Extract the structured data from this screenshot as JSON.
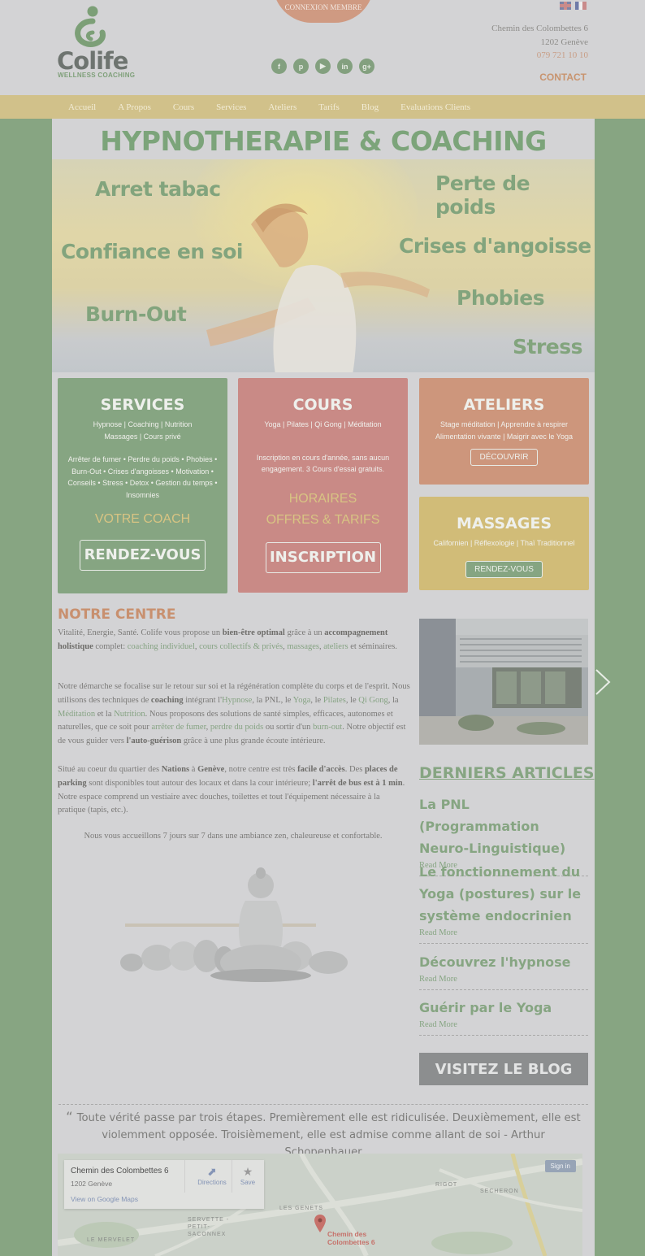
{
  "header": {
    "logo_text": "Colife",
    "logo_subtitle": "WELLNESS COACHING",
    "member_button": "CONNEXION MEMBRE",
    "social_icons": [
      "facebook-icon",
      "pinterest-icon",
      "youtube-icon",
      "linkedin-icon",
      "googleplus-icon"
    ],
    "social_glyphs": [
      "f",
      "p",
      "▶",
      "in",
      "g+"
    ],
    "languages": [
      "English",
      "Français"
    ],
    "address_line1": "Chemin des Colombettes 6",
    "address_line2": "1202 Genève",
    "phone": "079 721 10 10",
    "contact_label": "CONTACT"
  },
  "nav": {
    "items": [
      "Accueil",
      "A Propos",
      "Cours",
      "Services",
      "Ateliers",
      "Tarifs",
      "Blog",
      "Evaluations Clients"
    ]
  },
  "page_title": "HYPNOTHERAPIE & COACHING",
  "hero": {
    "words": [
      "Arret tabac",
      "Perte de poids",
      "Confiance en soi",
      "Crises d'angoisse",
      "Phobies",
      "Burn-Out",
      "Stress"
    ]
  },
  "cards": {
    "services": {
      "title": "SERVICES",
      "subtitle": "Hypnose | Coaching | Nutrition\nMassages | Cours privé",
      "description": "Arrêter de fumer • Perdre du poids • Phobies • Burn-Out • Crises d'angoisses • Motivation • Conseils • Stress • Detox • Gestion du temps • Insomnies",
      "coach_link": "VOTRE COACH",
      "button": "RENDEZ-VOUS"
    },
    "cours": {
      "title": "COURS",
      "subtitle": "Yoga | Pilates | Qi Gong | Méditation",
      "description": "Inscription en cours d'année, sans aucun engagement. 3 Cours d'essai gratuits.",
      "link1": "HORAIRES",
      "link2": "OFFRES & TARIFS",
      "button": "INSCRIPTION"
    },
    "ateliers": {
      "title": "ATELIERS",
      "subtitle": "Stage méditation | Apprendre à respirer\nAlimentation vivante | Maigrir avec le Yoga",
      "button": "DÉCOUVRIR"
    },
    "massages": {
      "title": "MASSAGES",
      "subtitle": "Californien | Réflexologie | Thaï Traditionnel",
      "button": "RENDEZ-VOUS"
    }
  },
  "centre": {
    "title": "NOTRE CENTRE",
    "p1_a": "Vitalité, Energie, Santé. Colife vous propose un ",
    "p1_b": "bien-être optimal",
    "p1_c": " grâce à un ",
    "p1_d": "accompagnement holistique",
    "p1_e": " complet: ",
    "p1_f": "coaching individuel",
    "p1_g": ", ",
    "p1_h": "cours collectifs & privés",
    "p1_i": ", ",
    "p1_j": "massages",
    "p1_k": ", ",
    "p1_l": "ateliers",
    "p1_m": " et séminaires.",
    "p2_a": "Notre démarche se focalise sur le retour sur soi et la régénération complète du corps et de l'esprit. Nous utilisons des techniques de ",
    "p2_b": "coaching",
    "p2_c": " intégrant l'",
    "p2_d": "Hypnose",
    "p2_e": ", la PNL, le ",
    "p2_f": "Yoga",
    "p2_g": ", le ",
    "p2_h": "Pilates",
    "p2_i": ", le ",
    "p2_j": "Qi Gong",
    "p2_k": ", la ",
    "p2_l": "Méditation",
    "p2_m": " et la ",
    "p2_n": "Nutrition",
    "p2_o": ". Nous proposons des solutions de santé simples, efficaces, autonomes et naturelles, que ce soit pour ",
    "p2_p": "arrêter de fumer",
    "p2_q": ", ",
    "p2_r": "perdre du poids",
    "p2_s": " ou sortir d'un ",
    "p2_t": "burn-out",
    "p2_u": ". Notre objectif est de vous guider vers ",
    "p2_v": "l'auto-guérison",
    "p2_w": " grâce à une plus grande écoute intérieure.",
    "p3_a": "Situé au coeur du quartier des ",
    "p3_b": "Nations",
    "p3_c": " à ",
    "p3_d": "Genève",
    "p3_e": ", notre centre est très ",
    "p3_f": "facile d'accès",
    "p3_g": ". Des ",
    "p3_h": "places de parking",
    "p3_i": " sont disponibles tout autour des locaux et dans la cour intérieure; ",
    "p3_j": "l'arrêt de bus est à 1 min",
    "p3_k": ". Notre espace comprend un vestiaire avec douches, toilettes et tout l'équipement nécessaire à la pratique (tapis, etc.).",
    "p4": "Nous vous accueillons 7 jours sur 7 dans une ambiance zen, chaleureuse et confortable."
  },
  "articles": {
    "title": "DERNIERS ARTICLES",
    "items": [
      {
        "title": "La PNL (Programmation Neuro-Linguistique)",
        "read_more": "Read More"
      },
      {
        "title": "Le fonctionnement du Yoga (postures) sur le système endocrinien",
        "read_more": "Read More"
      },
      {
        "title": "Découvrez l'hypnose",
        "read_more": "Read More"
      },
      {
        "title": "Guérir par le Yoga",
        "read_more": "Read More"
      }
    ],
    "blog_button": "VISITEZ LE BLOG"
  },
  "quote": {
    "text": "Toute vérité passe par trois étapes. Premièrement elle est ridiculisée. Deuxièmement, elle est violemment opposée. Troisièmement, elle est admise comme allant de soi - Arthur Schopenhauer"
  },
  "map": {
    "place_name": "Chemin des Colombettes 6",
    "place_city": "1202 Genève",
    "google_link": "View on Google Maps",
    "directions": "Directions",
    "save": "Save",
    "signin": "Sign in",
    "labels": [
      "SERVETTE - PETIT-SACONNEX",
      "LES GENETS",
      "LE MERVELET",
      "RIGOT",
      "SECHERON"
    ],
    "pin_label": "Chemin des Colombettes 6"
  },
  "colors": {
    "green": "#86a582",
    "salmon": "#c8906f",
    "services_card": "#86a582",
    "cours_card": "#c98a86",
    "ateliers_card": "#cd967c",
    "massages_card": "#d1bc78",
    "nav_bar": "#d1c18a"
  }
}
